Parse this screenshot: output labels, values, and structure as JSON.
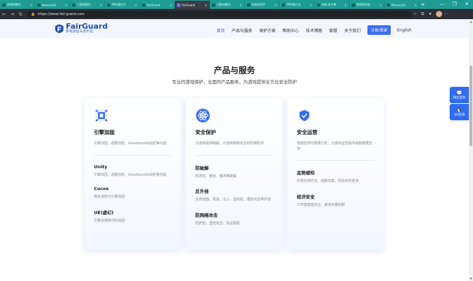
{
  "browser": {
    "tabs": [
      {
        "title": "游戏防解包",
        "active": false
      },
      {
        "title": "fileocos2d",
        "active": false
      },
      {
        "title": "三国杀解包",
        "active": false
      },
      {
        "title": "PNG图片打",
        "active": false
      },
      {
        "title": "FairGuard",
        "active": false
      },
      {
        "title": "FairGuard",
        "active": true
      },
      {
        "title": "已解决解包",
        "active": false
      },
      {
        "title": "所有的文件",
        "active": false
      },
      {
        "title": "PNG图片文",
        "active": false
      },
      {
        "title": "求助 求大神",
        "active": false
      },
      {
        "title": "游戏如何加",
        "active": false
      },
      {
        "title": "fileocos2d",
        "active": false
      }
    ],
    "close_glyph": "×",
    "new_tab": "+",
    "url": "https://www.fair-guard.com",
    "window_controls": [
      "—",
      "❐",
      "✕"
    ]
  },
  "header": {
    "brand": "FairGuard",
    "brand_sub": "游戏加固与反外挂",
    "nav": [
      {
        "label": "首页",
        "active": true
      },
      {
        "label": "产品与服务",
        "active": false
      },
      {
        "label": "保护方案",
        "active": false
      },
      {
        "label": "帮助中心",
        "active": false
      },
      {
        "label": "技术博客",
        "active": false
      },
      {
        "label": "套餐",
        "active": false
      },
      {
        "label": "关于我们",
        "active": false
      }
    ],
    "login": "注册/登录",
    "lang": "English"
  },
  "section": {
    "title": "产品与服务",
    "subtitle": "专业的游戏保护，全面的产品服务，为游戏提供全方位安全防护"
  },
  "cards": [
    {
      "icon": "engine-icon",
      "title": "引擎加固",
      "desc": "引擎加固、函数加密、Assetbundle加密等功能",
      "subs": [
        {
          "title": "Unity",
          "desc": "引擎加固、函数加密、Assetbundle加密等功能"
        },
        {
          "title": "Cocos",
          "desc": "脚本加密与引擎加固"
        },
        {
          "title": "UE(虚幻)",
          "desc": "引擎及游戏代码加固"
        }
      ]
    },
    {
      "icon": "shield-atom-icon",
      "title": "安全保护",
      "desc": "为游戏提供破解、外挂和网络攻击的防御防护",
      "subs": [
        {
          "title": "防破解",
          "desc": "防改包、越狱、篡改等破解"
        },
        {
          "title": "反外挂",
          "desc": "反修改器、变速、注入、虚拟机、模拟点击等外挂"
        },
        {
          "title": "防网络攻击",
          "desc": "防抓包、登陆攻击、协议脱机"
        }
      ]
    },
    {
      "icon": "security-ops-icon",
      "title": "安全运营",
      "desc": "智能检测与数据分析，为游戏运营提供威胁数据支持",
      "subs": [
        {
          "title": "态势感知",
          "desc": "外挂在线打击、威胁收集、风险实时查询"
        },
        {
          "title": "经济安全",
          "desc": "工作室智能定位、渠道买量防刷"
        }
      ]
    }
  ],
  "float": [
    {
      "icon": "chat-icon",
      "label": "微信咨询"
    },
    {
      "icon": "qq-icon",
      "label": "QQ咨询"
    }
  ],
  "colors": {
    "tab_bar": "#1e9d94",
    "accent": "#3a6ff0",
    "brand": "#1e4fa8"
  }
}
